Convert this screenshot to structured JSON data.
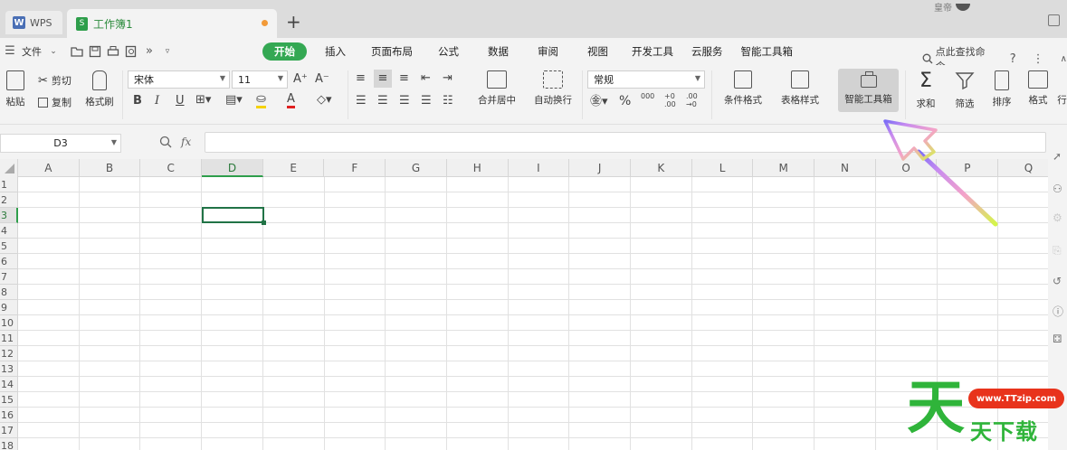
{
  "tabs": {
    "wps_label": "WPS",
    "doc_label": "工作簿1",
    "add_symbol": "+",
    "user_label": "皇帝"
  },
  "menu": {
    "file_label": "文件",
    "tabs": [
      "开始",
      "插入",
      "页面布局",
      "公式",
      "数据",
      "审阅",
      "视图",
      "开发工具",
      "云服务",
      "智能工具箱"
    ],
    "search_label": "点此查找命令",
    "help_symbol": "?",
    "accent_color": "#34a853"
  },
  "ribbon": {
    "paste": "粘贴",
    "cut": "剪切",
    "copy": "复制",
    "format_painter": "格式刷",
    "font_name": "宋体",
    "font_size": "11",
    "bold": "B",
    "italic": "I",
    "underline": "U",
    "font_color_letter": "A",
    "merge_center": "合并居中",
    "wrap_text": "自动换行",
    "number_format": "常规",
    "percent": "%",
    "thousands": "000",
    "conditional_format": "条件格式",
    "table_style": "表格样式",
    "smart_toolbox": "智能工具箱",
    "sum": "求和",
    "filter": "筛选",
    "sort": "排序",
    "format": "格式",
    "more": "行"
  },
  "formula": {
    "name_box": "D3",
    "fx_label": "fx",
    "value": ""
  },
  "sheet": {
    "columns": [
      "A",
      "B",
      "C",
      "D",
      "E",
      "F",
      "G",
      "H",
      "I",
      "J",
      "K",
      "L",
      "M",
      "N",
      "O",
      "P",
      "Q"
    ],
    "rows": [
      "1",
      "2",
      "3",
      "4",
      "5",
      "6",
      "7",
      "8",
      "9",
      "10",
      "11",
      "12",
      "13",
      "14",
      "15",
      "16",
      "17",
      "18"
    ],
    "active_cell": "D3",
    "selection_color": "#217346"
  },
  "watermark": {
    "big_char": "天",
    "url": "www.TTzip.com",
    "text": "天下载",
    "green": "#2fb43a",
    "red": "#e8331c"
  }
}
